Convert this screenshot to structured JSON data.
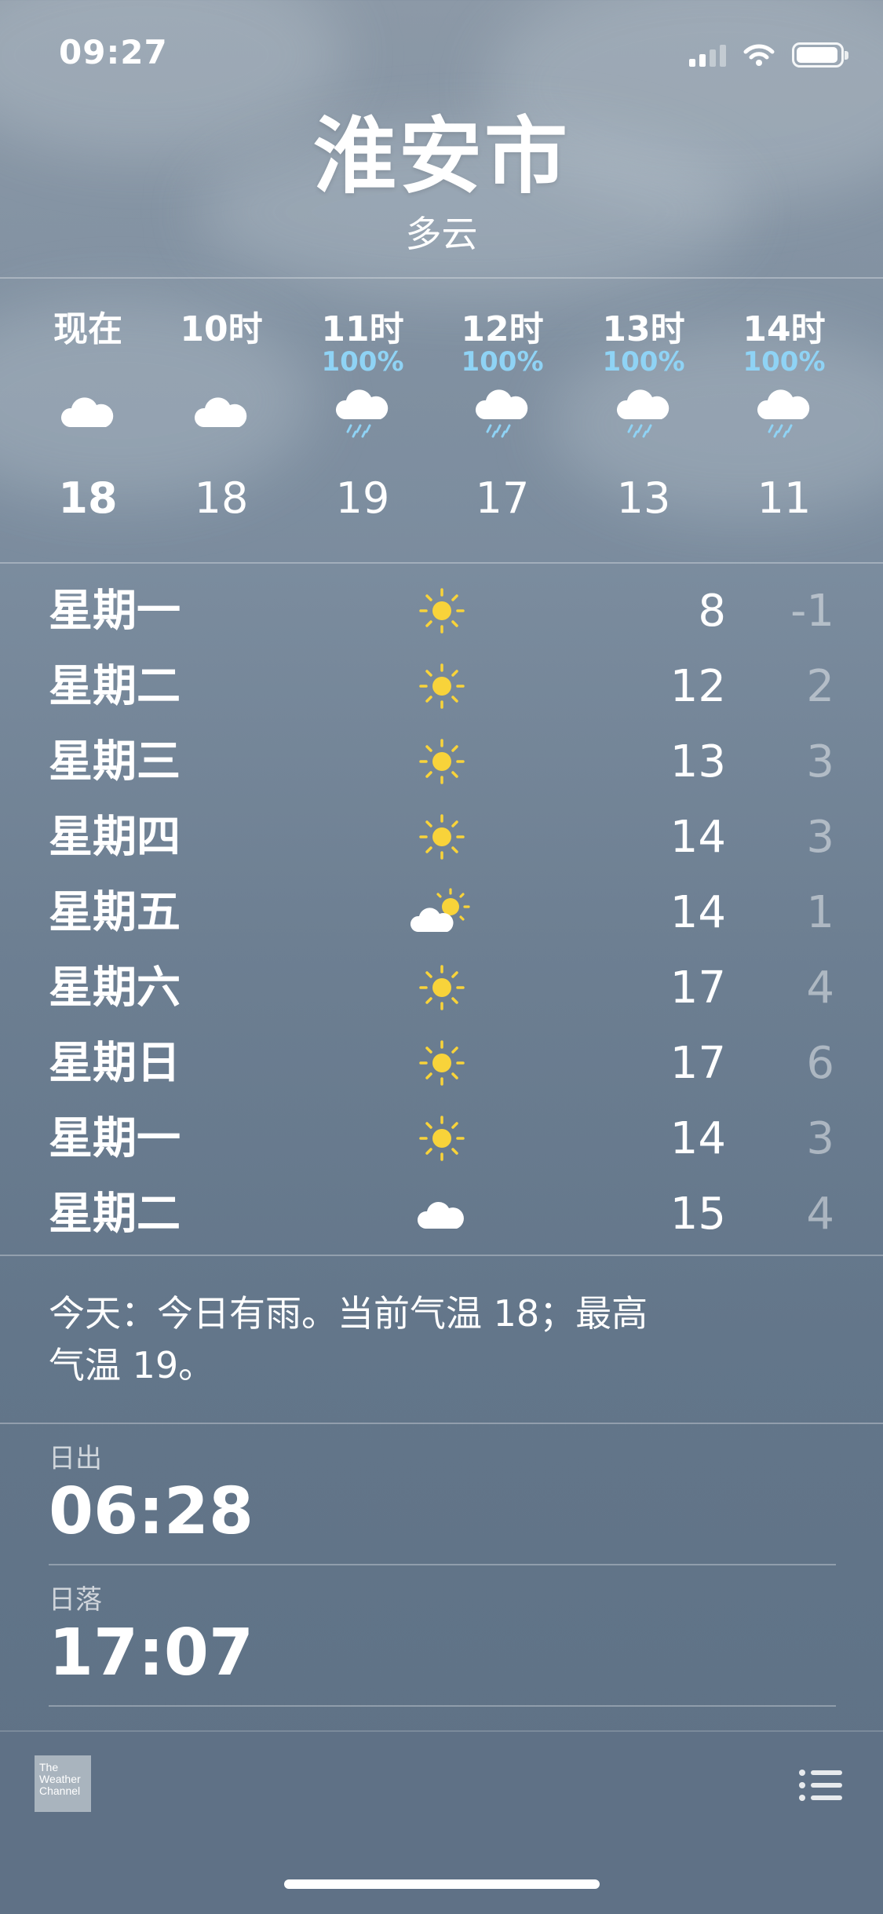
{
  "status_bar": {
    "time": "09:27"
  },
  "header": {
    "city": "淮安市",
    "condition": "多云"
  },
  "hourly": [
    {
      "label": "现在",
      "precip": "",
      "icon": "cloud-icon",
      "temp": "18"
    },
    {
      "label": "10时",
      "precip": "",
      "icon": "cloud-icon",
      "temp": "18"
    },
    {
      "label": "11时",
      "precip": "100%",
      "icon": "rain-icon",
      "temp": "19"
    },
    {
      "label": "12时",
      "precip": "100%",
      "icon": "rain-icon",
      "temp": "17"
    },
    {
      "label": "13时",
      "precip": "100%",
      "icon": "rain-icon",
      "temp": "13"
    },
    {
      "label": "14时",
      "precip": "100%",
      "icon": "rain-icon",
      "temp": "11"
    }
  ],
  "daily": [
    {
      "day": "星期一",
      "icon": "sun-icon",
      "high": "8",
      "low": "-1"
    },
    {
      "day": "星期二",
      "icon": "sun-icon",
      "high": "12",
      "low": "2"
    },
    {
      "day": "星期三",
      "icon": "sun-icon",
      "high": "13",
      "low": "3"
    },
    {
      "day": "星期四",
      "icon": "sun-icon",
      "high": "14",
      "low": "3"
    },
    {
      "day": "星期五",
      "icon": "partly-cloudy-icon",
      "high": "14",
      "low": "1"
    },
    {
      "day": "星期六",
      "icon": "sun-icon",
      "high": "17",
      "low": "4"
    },
    {
      "day": "星期日",
      "icon": "sun-icon",
      "high": "17",
      "low": "6"
    },
    {
      "day": "星期一",
      "icon": "sun-icon",
      "high": "14",
      "low": "3"
    },
    {
      "day": "星期二",
      "icon": "cloud-icon",
      "high": "15",
      "low": "4"
    }
  ],
  "summary": {
    "line1": "今天：今日有雨。当前气温 18；最高",
    "line2": "气温 19。"
  },
  "details": {
    "sunrise_label": "日出",
    "sunrise": "06:28",
    "sunset_label": "日落",
    "sunset": "17:07"
  },
  "footer": {
    "logo_text": "The Weather Channel"
  },
  "colors": {
    "precip": "#8fd3f5",
    "sun": "#f8d33a",
    "background_top": "#8c99a7",
    "background_bottom": "#5e7185"
  }
}
